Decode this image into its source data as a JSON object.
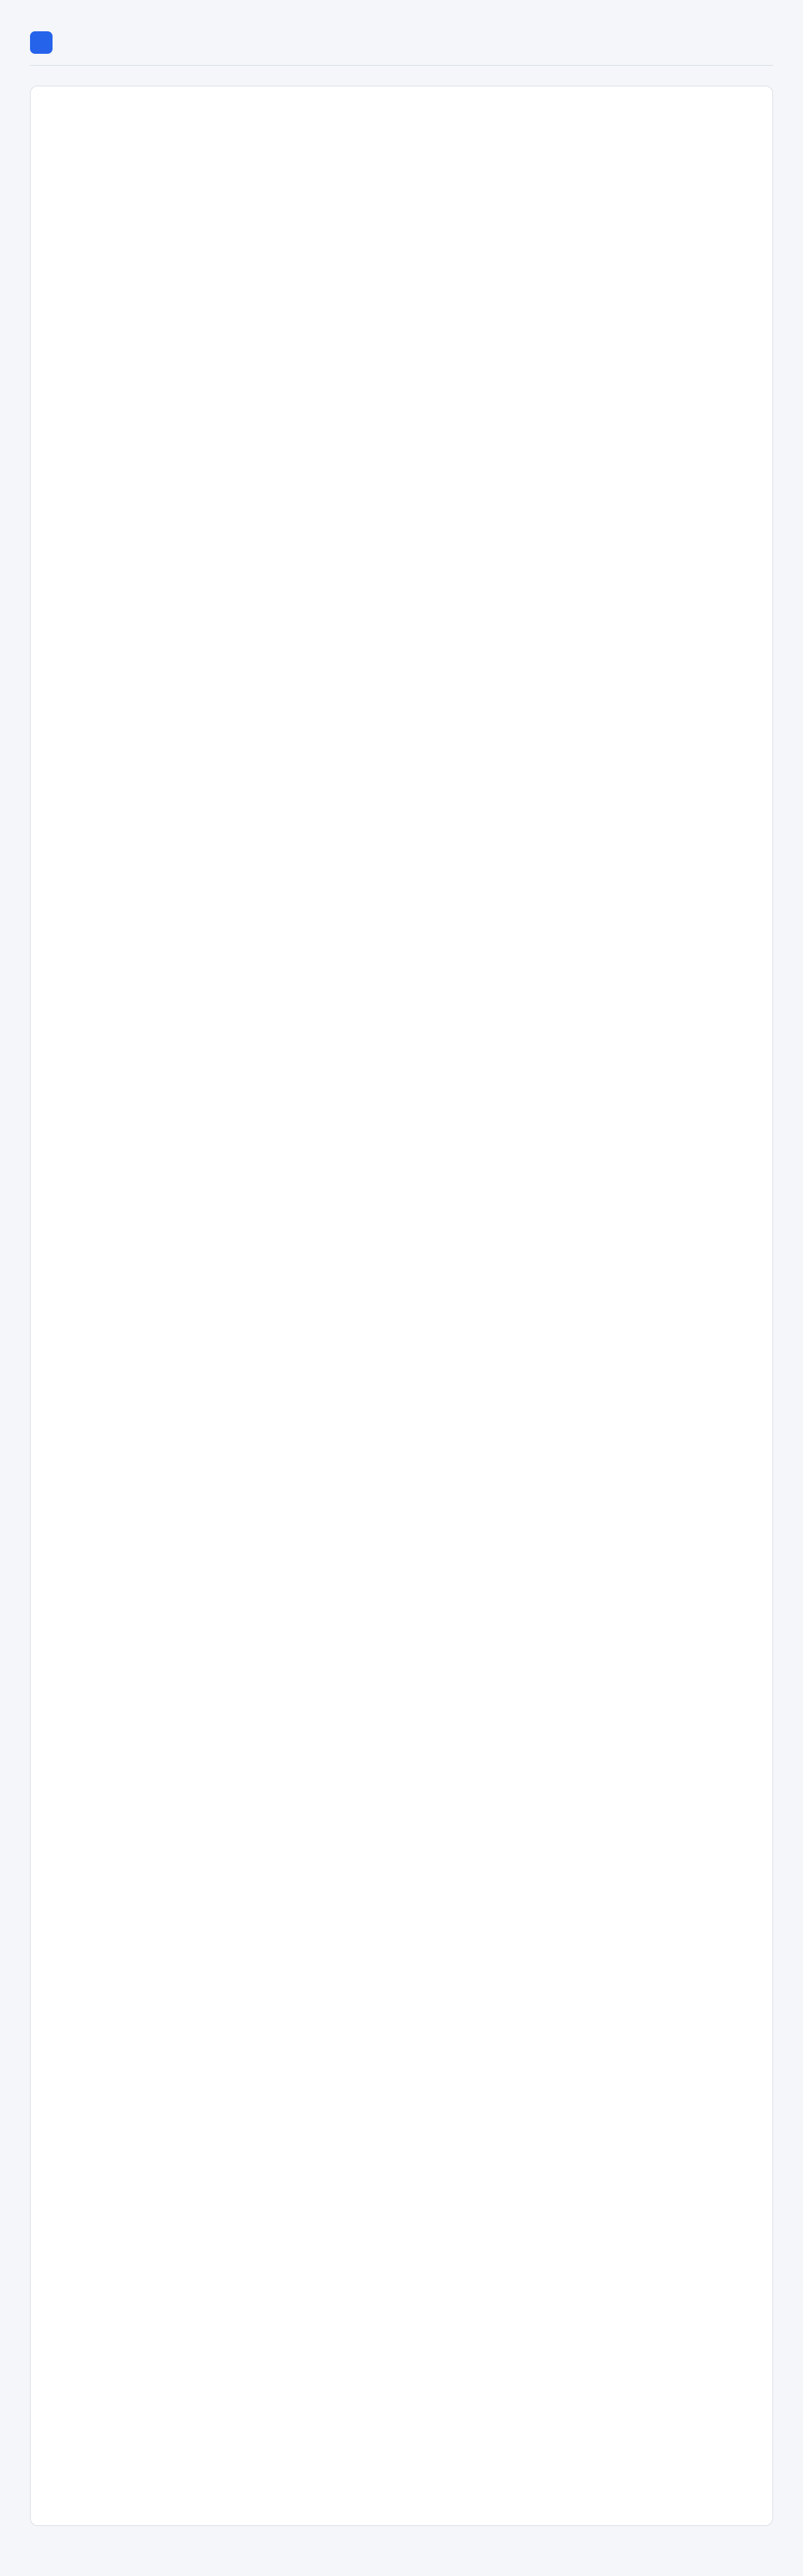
{
  "app": {
    "title": "",
    "notice": ""
  }
}
